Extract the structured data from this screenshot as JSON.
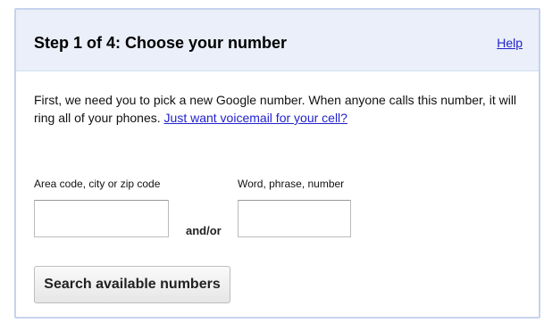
{
  "dialog": {
    "title": "Step 1 of 4: Choose your number",
    "help_link": "Help"
  },
  "intro": {
    "text": "First, we need you to pick a new Google number. When anyone calls this number, it will ring all of your phones.",
    "voicemail_link": "Just want voicemail for your cell?"
  },
  "form": {
    "area_label": "Area code, city or zip code",
    "area_value": "",
    "word_label": "Word, phrase, number",
    "word_value": "",
    "andor": "and/or",
    "search_button": "Search available numbers"
  }
}
